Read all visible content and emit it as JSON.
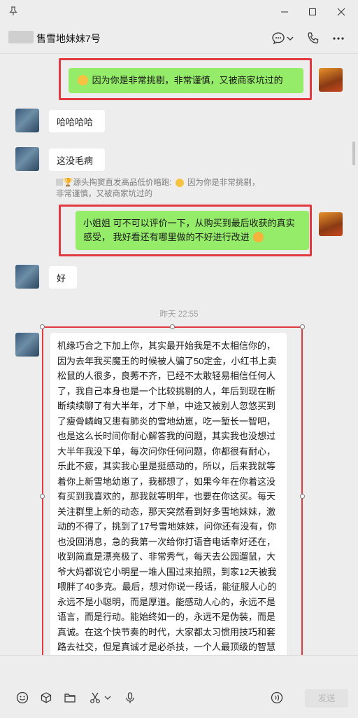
{
  "window": {
    "pin_icon": "pin-icon",
    "controls": [
      "minimize-icon",
      "maximize-icon",
      "close-icon"
    ]
  },
  "header": {
    "title": "售雪地妹妹7号",
    "icons": [
      "chat-more-icon",
      "phone-icon",
      "more-icon"
    ]
  },
  "messages": {
    "m1": {
      "side": "right",
      "text": "因为你是非常挑剔，非常谨慎，又被商家坑过的",
      "emoji": "grin-emoji"
    },
    "m2": {
      "side": "left",
      "text": "哈哈哈哈"
    },
    "m3": {
      "side": "left",
      "text": "这没毛病"
    },
    "quote": {
      "author": "源头掏窦直发高品低价暗跑:",
      "text": "因为你是非常挑剔，非常谨慎，又被商家坑过的",
      "icon": "trophy-icon"
    },
    "m4": {
      "side": "right",
      "text": "小姐姐 可不可以评价一下，从购买到最后收获的真实感受， 我好看还有哪里做的不好进行改进",
      "emoji": "smile-emoji"
    },
    "m5": {
      "side": "left",
      "text": "好"
    },
    "timestamp": "昨天 22:55",
    "m6": {
      "side": "left",
      "text": "机缘巧合之下加上你，其实最开始我是不太相信你的，因为去年我买魔王的时候被人骗了50定金，小红书上卖松鼠的人很多，良莠不齐，已经不太敢轻易相信任何人了，我自己本身也是一个比较挑剔的人，年后到现在断断续续聊了有大半年，才下单，中途又被别人忽悠买到了瘦骨嶙峋又患有肺炎的雪地幼崽，吃一堑长一智吧，也是这么长时间你耐心解答我的问题，其实我也没想过大半年我没下单，每次问你任何问题，你都很有耐心，乐此不疲，其实我心里是挺感动的，所以，后来我就等着你上新雪地幼崽了，我都想了，如果今年在你着这没有买到我喜欢的，那我就等明年，也要在你这买。每天关注群里上新的动态，那天突然看到好多雪地妹妹，激动的不得了，挑到了17号雪地妹妹，问你还有没有，你也没回消息，急的我第一次给你打语音电话幸好还在，收到简直是漂亮极了、非常秀气，每天去公园遛鼠，大爷大妈都说它小明星一堆人围过来拍照，到家12天被我喂胖了40多克。最后，想对你说一段话，能征服人心的永远不是小聪明，而是厚道。能感动人心的，永远不是语言，而是行动。能始终如一的，永远不是伪装，而是真诚。在这个快节奏的时代，大家都太习惯用技巧和套路去社交，但是真诚才是必杀技，一个人最顶级的智慧就是“真诚”，唯有真诚待人，才会站的高，走的更远，而你做到了!"
    }
  },
  "input": {
    "tools": [
      "emoji-icon",
      "favorites-icon",
      "folder-icon",
      "scissors-icon",
      "mic-icon"
    ],
    "voice_icon": "voice-call-icon",
    "send_label": "发送"
  },
  "colors": {
    "background": "#ededed",
    "bubble_green": "#95ec69",
    "bubble_white": "#ffffff",
    "highlight_red": "#e2383f"
  }
}
